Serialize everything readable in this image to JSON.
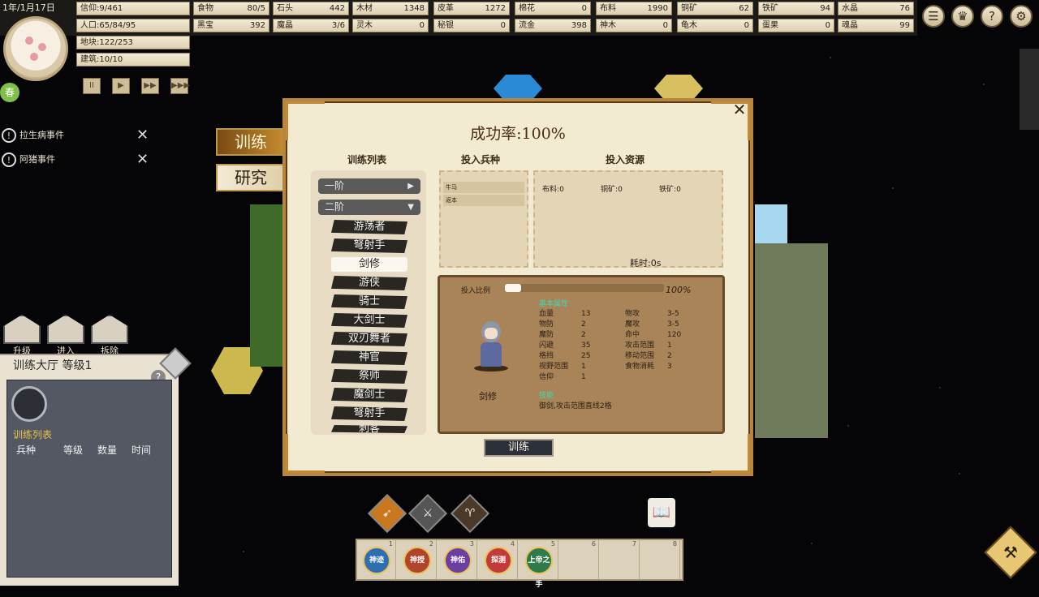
{
  "top_bar": {
    "date": "1年/1月17日",
    "left_stats": [
      {
        "label": "信仰",
        "value": "9/461"
      },
      {
        "label": "人口",
        "value": "65/84/95"
      },
      {
        "label": "地块",
        "value": "122/253"
      },
      {
        "label": "建筑",
        "value": "10/10"
      }
    ],
    "resources_row1": [
      {
        "label": "食物",
        "value": "80/5"
      },
      {
        "label": "石头",
        "value": "442"
      },
      {
        "label": "木材",
        "value": "1348"
      },
      {
        "label": "皮革",
        "value": "1272"
      },
      {
        "label": "棉花",
        "value": "0"
      },
      {
        "label": "布料",
        "value": "1990"
      },
      {
        "label": "铜矿",
        "value": "62"
      },
      {
        "label": "铁矿",
        "value": "94"
      },
      {
        "label": "水晶",
        "value": "76"
      }
    ],
    "resources_row2": [
      {
        "label": "黑宝",
        "value": "392"
      },
      {
        "label": "魔晶",
        "value": "3/6"
      },
      {
        "label": "灵木",
        "value": "0"
      },
      {
        "label": "秘银",
        "value": "0"
      },
      {
        "label": "流金",
        "value": "398"
      },
      {
        "label": "神木",
        "value": "0"
      },
      {
        "label": "龟木",
        "value": "0"
      },
      {
        "label": "蛋果",
        "value": "0"
      },
      {
        "label": "魂晶",
        "value": "99"
      }
    ],
    "season": "春",
    "speed_buttons": [
      "II",
      "▶",
      "▶▶",
      "▶▶▶"
    ],
    "right_icons": [
      "list-icon",
      "crown-icon",
      "help-icon",
      "gear-icon"
    ]
  },
  "events": [
    {
      "text": "拉生病事件"
    },
    {
      "text": "阿猪事件"
    }
  ],
  "side_tabs": {
    "train": "训练",
    "research": "研究"
  },
  "building": {
    "actions": [
      "升级",
      "进入",
      "拆除"
    ],
    "title": "训练大厅 等级1",
    "list_label": "训练列表",
    "columns": [
      "兵种",
      "等级",
      "数量",
      "时间"
    ]
  },
  "dialog": {
    "success_rate": "成功率:100%",
    "col_list": "训练列表",
    "col_unit": "投入兵种",
    "col_resource": "投入资源",
    "tiers": [
      {
        "label": "一阶",
        "arrow": "▶"
      },
      {
        "label": "二阶",
        "arrow": "▼"
      }
    ],
    "units": [
      "游荡者",
      "弩射手",
      "剑修",
      "游侠",
      "骑士",
      "大剑士",
      "双刃舞者",
      "神官",
      "祭师",
      "魔剑士",
      "弩射手",
      "刺客"
    ],
    "selected_unit": "剑修",
    "unit_slots": [
      "牛马",
      "返本"
    ],
    "resource_costs": [
      {
        "label": "布料",
        "value": "0"
      },
      {
        "label": "铜矿",
        "value": "0"
      },
      {
        "label": "铁矿",
        "value": "0"
      }
    ],
    "time_label": "耗时:0s",
    "ratio_label": "投入比例",
    "ratio_value": 0.1,
    "ratio_pct": "100%",
    "hero_name": "剑修",
    "attr_title": "基本属性",
    "attrs_left": [
      {
        "k": "血量",
        "v": "13"
      },
      {
        "k": "物防",
        "v": "2"
      },
      {
        "k": "魔防",
        "v": "2"
      },
      {
        "k": "闪避",
        "v": "35"
      },
      {
        "k": "格挡",
        "v": "25"
      },
      {
        "k": "视野范围",
        "v": "1"
      },
      {
        "k": "信仰",
        "v": "1"
      }
    ],
    "attrs_right": [
      {
        "k": "物攻",
        "v": "3-5"
      },
      {
        "k": "魔攻",
        "v": "3-5"
      },
      {
        "k": "命中",
        "v": "120"
      },
      {
        "k": "攻击范围",
        "v": "1"
      },
      {
        "k": "移动范围",
        "v": "2"
      },
      {
        "k": "食物消耗",
        "v": "3"
      }
    ],
    "skill_title": "技能",
    "skill_desc": "御剑,攻击范围直线2格",
    "train_button": "训练"
  },
  "bottom_bar": {
    "slots": [
      {
        "num": "1",
        "label": "神迹",
        "color": "#2d6fb0"
      },
      {
        "num": "2",
        "label": "神授",
        "color": "#b0442d"
      },
      {
        "num": "3",
        "label": "神佑",
        "color": "#6a3fa0"
      },
      {
        "num": "4",
        "label": "探测",
        "color": "#c23a3a"
      },
      {
        "num": "5",
        "label": "上帝之手",
        "color": "#2f7a4a"
      },
      {
        "num": "6",
        "label": ""
      },
      {
        "num": "7",
        "label": ""
      },
      {
        "num": "8",
        "label": ""
      }
    ]
  }
}
